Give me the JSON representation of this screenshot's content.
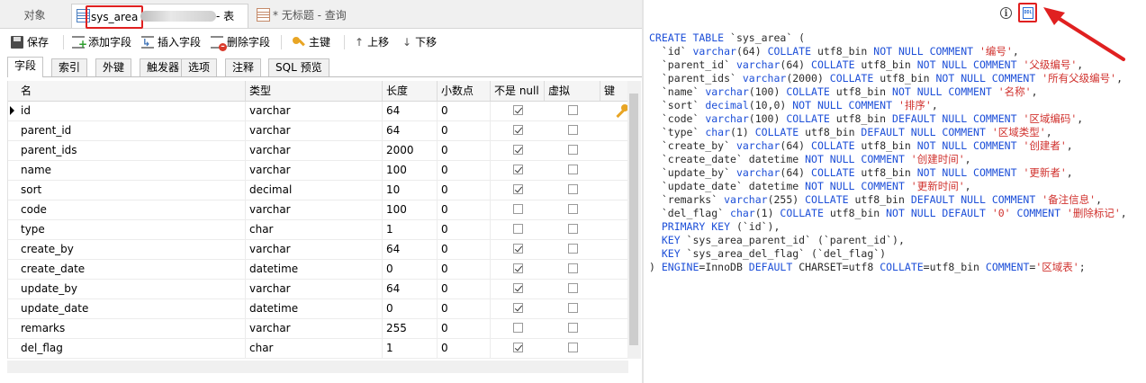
{
  "tabs": [
    {
      "label": "对象"
    },
    {
      "label": "sys_area",
      "suffix": "- 表"
    },
    {
      "label": "* 无标题 - 查询"
    }
  ],
  "toolbar": {
    "save": "保存",
    "add_field": "添加字段",
    "insert_field": "插入字段",
    "delete_field": "删除字段",
    "primary_key": "主键",
    "move_up": "上移",
    "move_down": "下移"
  },
  "subtabs": [
    "字段",
    "索引",
    "外键",
    "触发器",
    "选项",
    "注释",
    "SQL 预览"
  ],
  "columns": [
    "名",
    "类型",
    "长度",
    "小数点",
    "不是 null",
    "虚拟",
    "键"
  ],
  "fields": [
    {
      "name": "id",
      "type": "varchar",
      "length": "64",
      "decimals": "0",
      "not_null": true,
      "pk": true
    },
    {
      "name": "parent_id",
      "type": "varchar",
      "length": "64",
      "decimals": "0",
      "not_null": true,
      "pk": false
    },
    {
      "name": "parent_ids",
      "type": "varchar",
      "length": "2000",
      "decimals": "0",
      "not_null": true,
      "pk": false
    },
    {
      "name": "name",
      "type": "varchar",
      "length": "100",
      "decimals": "0",
      "not_null": true,
      "pk": false
    },
    {
      "name": "sort",
      "type": "decimal",
      "length": "10",
      "decimals": "0",
      "not_null": true,
      "pk": false
    },
    {
      "name": "code",
      "type": "varchar",
      "length": "100",
      "decimals": "0",
      "not_null": false,
      "pk": false
    },
    {
      "name": "type",
      "type": "char",
      "length": "1",
      "decimals": "0",
      "not_null": false,
      "pk": false
    },
    {
      "name": "create_by",
      "type": "varchar",
      "length": "64",
      "decimals": "0",
      "not_null": true,
      "pk": false
    },
    {
      "name": "create_date",
      "type": "datetime",
      "length": "0",
      "decimals": "0",
      "not_null": true,
      "pk": false
    },
    {
      "name": "update_by",
      "type": "varchar",
      "length": "64",
      "decimals": "0",
      "not_null": true,
      "pk": false
    },
    {
      "name": "update_date",
      "type": "datetime",
      "length": "0",
      "decimals": "0",
      "not_null": true,
      "pk": false
    },
    {
      "name": "remarks",
      "type": "varchar",
      "length": "255",
      "decimals": "0",
      "not_null": false,
      "pk": false
    },
    {
      "name": "del_flag",
      "type": "char",
      "length": "1",
      "decimals": "0",
      "not_null": true,
      "pk": false
    }
  ],
  "info_icon": "i",
  "ddl_icon": "DDL",
  "sql_preview": [
    [
      [
        "kw",
        "CREATE TABLE "
      ],
      [
        "plain",
        "`sys_area` ("
      ]
    ],
    [
      [
        "plain",
        "  `id` "
      ],
      [
        "kw",
        "varchar"
      ],
      [
        "plain",
        "(64) "
      ],
      [
        "kw",
        "COLLATE "
      ],
      [
        "plain",
        "utf8_bin "
      ],
      [
        "kw",
        "NOT NULL COMMENT "
      ],
      [
        "str",
        "'编号'"
      ],
      [
        "plain",
        ","
      ]
    ],
    [
      [
        "plain",
        "  `parent_id` "
      ],
      [
        "kw",
        "varchar"
      ],
      [
        "plain",
        "(64) "
      ],
      [
        "kw",
        "COLLATE "
      ],
      [
        "plain",
        "utf8_bin "
      ],
      [
        "kw",
        "NOT NULL COMMENT "
      ],
      [
        "str",
        "'父级编号'"
      ],
      [
        "plain",
        ","
      ]
    ],
    [
      [
        "plain",
        "  `parent_ids` "
      ],
      [
        "kw",
        "varchar"
      ],
      [
        "plain",
        "(2000) "
      ],
      [
        "kw",
        "COLLATE "
      ],
      [
        "plain",
        "utf8_bin "
      ],
      [
        "kw",
        "NOT NULL COMMENT "
      ],
      [
        "str",
        "'所有父级编号'"
      ],
      [
        "plain",
        ","
      ]
    ],
    [
      [
        "plain",
        "  `name` "
      ],
      [
        "kw",
        "varchar"
      ],
      [
        "plain",
        "(100) "
      ],
      [
        "kw",
        "COLLATE "
      ],
      [
        "plain",
        "utf8_bin "
      ],
      [
        "kw",
        "NOT NULL COMMENT "
      ],
      [
        "str",
        "'名称'"
      ],
      [
        "plain",
        ","
      ]
    ],
    [
      [
        "plain",
        "  `sort` "
      ],
      [
        "kw",
        "decimal"
      ],
      [
        "plain",
        "(10,0) "
      ],
      [
        "kw",
        "NOT NULL COMMENT "
      ],
      [
        "str",
        "'排序'"
      ],
      [
        "plain",
        ","
      ]
    ],
    [
      [
        "plain",
        "  `code` "
      ],
      [
        "kw",
        "varchar"
      ],
      [
        "plain",
        "(100) "
      ],
      [
        "kw",
        "COLLATE "
      ],
      [
        "plain",
        "utf8_bin "
      ],
      [
        "kw",
        "DEFAULT NULL COMMENT "
      ],
      [
        "str",
        "'区域编码'"
      ],
      [
        "plain",
        ","
      ]
    ],
    [
      [
        "plain",
        "  `type` "
      ],
      [
        "kw",
        "char"
      ],
      [
        "plain",
        "(1) "
      ],
      [
        "kw",
        "COLLATE "
      ],
      [
        "plain",
        "utf8_bin "
      ],
      [
        "kw",
        "DEFAULT NULL COMMENT "
      ],
      [
        "str",
        "'区域类型'"
      ],
      [
        "plain",
        ","
      ]
    ],
    [
      [
        "plain",
        "  `create_by` "
      ],
      [
        "kw",
        "varchar"
      ],
      [
        "plain",
        "(64) "
      ],
      [
        "kw",
        "COLLATE "
      ],
      [
        "plain",
        "utf8_bin "
      ],
      [
        "kw",
        "NOT NULL COMMENT "
      ],
      [
        "str",
        "'创建者'"
      ],
      [
        "plain",
        ","
      ]
    ],
    [
      [
        "plain",
        "  `create_date` datetime "
      ],
      [
        "kw",
        "NOT NULL COMMENT "
      ],
      [
        "str",
        "'创建时间'"
      ],
      [
        "plain",
        ","
      ]
    ],
    [
      [
        "plain",
        "  `update_by` "
      ],
      [
        "kw",
        "varchar"
      ],
      [
        "plain",
        "(64) "
      ],
      [
        "kw",
        "COLLATE "
      ],
      [
        "plain",
        "utf8_bin "
      ],
      [
        "kw",
        "NOT NULL COMMENT "
      ],
      [
        "str",
        "'更新者'"
      ],
      [
        "plain",
        ","
      ]
    ],
    [
      [
        "plain",
        "  `update_date` datetime "
      ],
      [
        "kw",
        "NOT NULL COMMENT "
      ],
      [
        "str",
        "'更新时间'"
      ],
      [
        "plain",
        ","
      ]
    ],
    [
      [
        "plain",
        "  `remarks` "
      ],
      [
        "kw",
        "varchar"
      ],
      [
        "plain",
        "(255) "
      ],
      [
        "kw",
        "COLLATE "
      ],
      [
        "plain",
        "utf8_bin "
      ],
      [
        "kw",
        "DEFAULT NULL COMMENT "
      ],
      [
        "str",
        "'备注信息'"
      ],
      [
        "plain",
        ","
      ]
    ],
    [
      [
        "plain",
        "  `del_flag` "
      ],
      [
        "kw",
        "char"
      ],
      [
        "plain",
        "(1) "
      ],
      [
        "kw",
        "COLLATE "
      ],
      [
        "plain",
        "utf8_bin "
      ],
      [
        "kw",
        "NOT NULL DEFAULT "
      ],
      [
        "str",
        "'0'"
      ],
      [
        "kw",
        " COMMENT "
      ],
      [
        "str",
        "'删除标记'"
      ],
      [
        "plain",
        ","
      ]
    ],
    [
      [
        "kw",
        "  PRIMARY KEY "
      ],
      [
        "plain",
        "(`id`),"
      ]
    ],
    [
      [
        "kw",
        "  KEY "
      ],
      [
        "plain",
        "`sys_area_parent_id` (`parent_id`),"
      ]
    ],
    [
      [
        "kw",
        "  KEY "
      ],
      [
        "plain",
        "`sys_area_del_flag` (`del_flag`)"
      ]
    ],
    [
      [
        "plain",
        ") "
      ],
      [
        "kw",
        "ENGINE"
      ],
      [
        "plain",
        "=InnoDB "
      ],
      [
        "kw",
        "DEFAULT "
      ],
      [
        "plain",
        "CHARSET=utf8 "
      ],
      [
        "kw",
        "COLLATE"
      ],
      [
        "plain",
        "=utf8_bin "
      ],
      [
        "kw",
        "COMMENT"
      ],
      [
        "plain",
        "="
      ],
      [
        "str",
        "'区域表'"
      ],
      [
        "plain",
        ";"
      ]
    ]
  ],
  "colors": {
    "keyword": "#1d4fd8",
    "string": "#d0312d",
    "highlight": "#e02020"
  }
}
